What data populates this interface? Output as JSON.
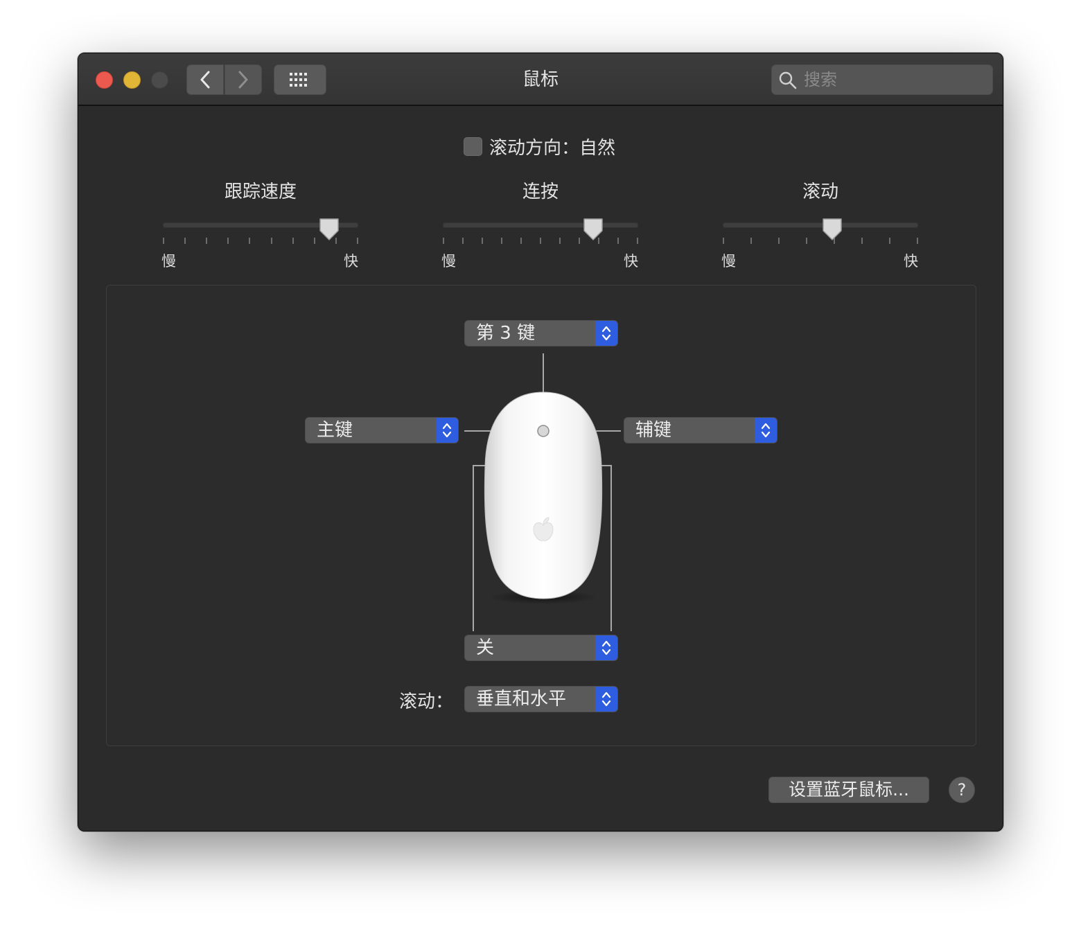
{
  "window": {
    "title": "鼠标"
  },
  "toolbar": {
    "back_icon": "chevron-left-icon",
    "forward_icon": "chevron-right-icon",
    "grid_icon": "grid-icon",
    "search_placeholder": "搜索"
  },
  "scroll_direction": {
    "label": "滚动方向：自然",
    "checked": false
  },
  "sliders": [
    {
      "title": "跟踪速度",
      "min_label": "慢",
      "max_label": "快",
      "ticks": 10,
      "value_fraction": 0.85
    },
    {
      "title": "连按",
      "min_label": "慢",
      "max_label": "快",
      "ticks": 11,
      "value_fraction": 0.77
    },
    {
      "title": "滚动",
      "min_label": "慢",
      "max_label": "快",
      "ticks": 8,
      "value_fraction": 0.56
    }
  ],
  "buttons_config": {
    "top": "第 3 键",
    "left": "主键",
    "right": "辅键",
    "side": "关",
    "scroll_label": "滚动：",
    "scroll_value": "垂直和水平"
  },
  "footer": {
    "bluetooth_button": "设置蓝牙鼠标...",
    "help_button": "?"
  },
  "colors": {
    "accent": "#2f5de0",
    "background": "#2b2b2b"
  }
}
